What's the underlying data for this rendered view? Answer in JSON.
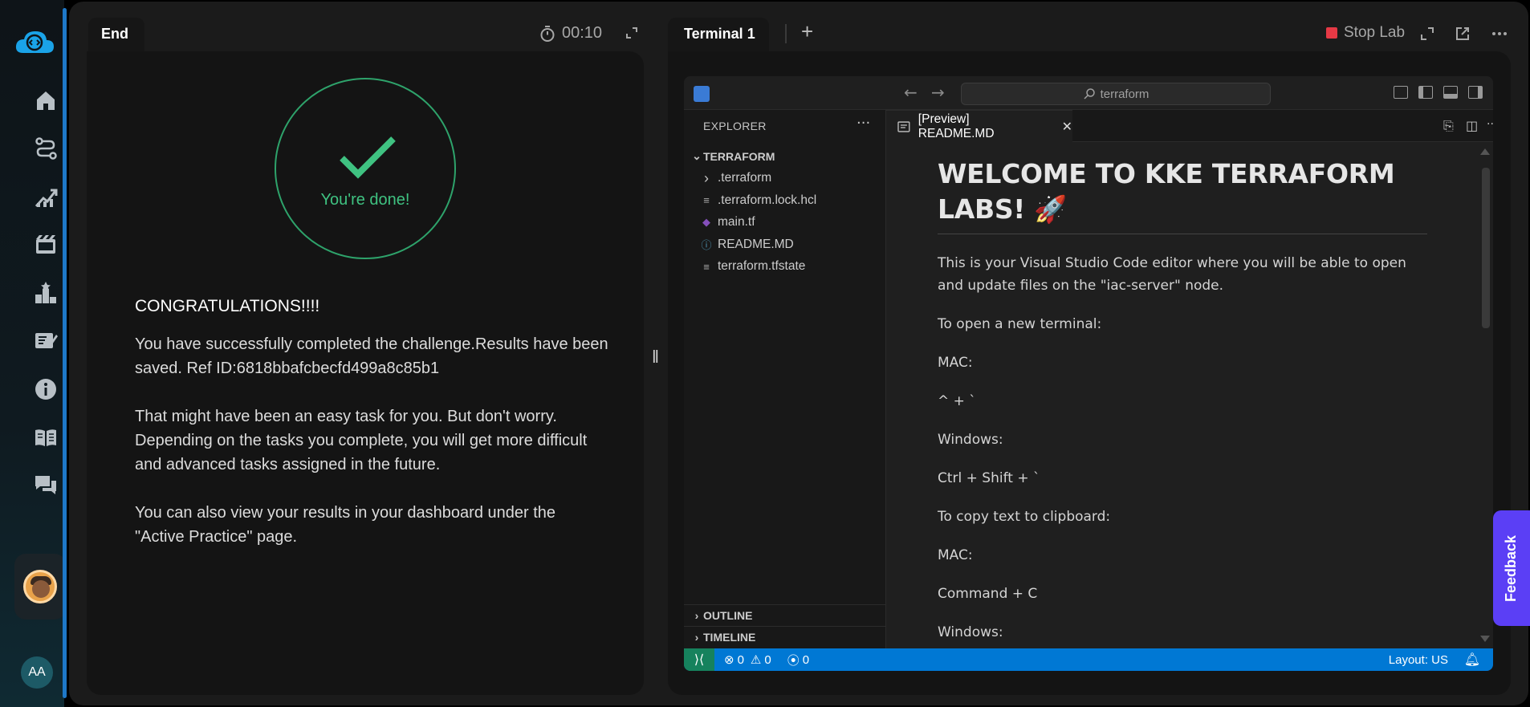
{
  "app": {
    "initials": "AA",
    "nav_icons": [
      "home-icon",
      "path-icon",
      "progress-icon",
      "video-icon",
      "leaderboard-icon",
      "notes-icon",
      "info-icon",
      "book-icon",
      "chat-icon"
    ]
  },
  "left_panel": {
    "tab_label": "End",
    "timer": "00:10",
    "done_text": "You're done!",
    "heading": "CONGRATULATIONS!!!!",
    "paragraphs": [
      "You have successfully completed the challenge.Results have been saved. Ref ID:6818bbafcbecfd499a8c85b1",
      "That might have been an easy task for you. But don't worry. Depending on the tasks you complete, you will get more difficult and advanced tasks assigned in the future.",
      "You can also view your results in your dashboard under the \"Active Practice\" page."
    ]
  },
  "right_panel": {
    "tab_label": "Terminal 1",
    "add_tab": "+",
    "stop_label": "Stop Lab"
  },
  "vscode": {
    "search_text": "terraform",
    "explorer_title": "EXPLORER",
    "explorer_dots": "···",
    "root_folder": "TERRAFORM",
    "files": [
      {
        "name": ".terraform",
        "icon": "›"
      },
      {
        "name": ".terraform.lock.hcl",
        "icon": "≡"
      },
      {
        "name": "main.tf",
        "icon": "◆"
      },
      {
        "name": "README.MD",
        "icon": "ⓘ"
      },
      {
        "name": "terraform.tfstate",
        "icon": "≡"
      }
    ],
    "outline": "OUTLINE",
    "timeline": "TIMELINE",
    "editor_tab": "[Preview] README.MD",
    "doc": {
      "title": "WELCOME TO KKE TERRAFORM LABS! 🚀",
      "lines": [
        "This is your Visual Studio Code editor where you will be able to open and update files on the \"iac-server\" node.",
        "To open a new terminal:",
        "MAC:",
        "^ + `",
        "Windows:",
        "Ctrl + Shift + `",
        "To copy text to clipboard:",
        "MAC:",
        "Command + C",
        "Windows:"
      ]
    },
    "status": {
      "errors": "0",
      "warnings": "0",
      "ports": "0",
      "layout": "Layout: US"
    }
  },
  "feedback_label": "Feedback"
}
